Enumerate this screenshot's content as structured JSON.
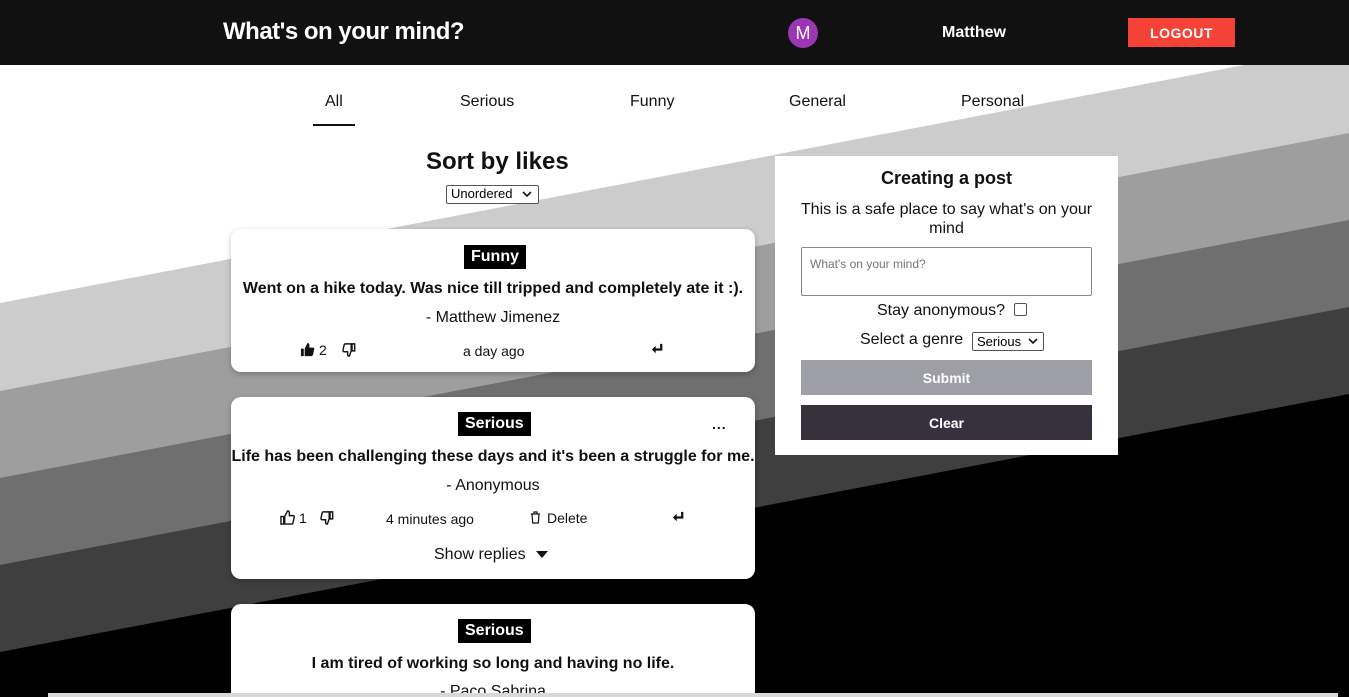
{
  "header": {
    "app_title": "What's on your mind?",
    "avatar_letter": "M",
    "username": "Matthew",
    "logout_label": "LOGOUT"
  },
  "tabs": [
    {
      "label": "All",
      "active": true
    },
    {
      "label": "Serious",
      "active": false
    },
    {
      "label": "Funny",
      "active": false
    },
    {
      "label": "General",
      "active": false
    },
    {
      "label": "Personal",
      "active": false
    }
  ],
  "sort": {
    "title": "Sort by likes",
    "selected": "Unordered"
  },
  "posts": [
    {
      "genre": "Funny",
      "text": "Went on a hike today. Was nice till tripped and completely ate it :).",
      "author": "- Matthew Jimenez",
      "likes": "2",
      "liked": true,
      "time": "a day ago"
    },
    {
      "genre": "Serious",
      "text": "Life has been challenging these days and it's been a struggle for me.",
      "author": "- Anonymous",
      "likes": "1",
      "liked": false,
      "time": "4 minutes ago",
      "delete_label": "Delete",
      "more_label": "...",
      "show_replies_label": "Show replies"
    },
    {
      "genre": "Serious",
      "text": "I am tired of working so long and having no life.",
      "author": "- Paco Sabrina"
    }
  ],
  "create_post": {
    "title": "Creating a post",
    "subtitle": "This is a safe place to say what's on your mind",
    "input_placeholder": "What's on your mind?",
    "anonymous_label": "Stay anonymous?",
    "genre_label": "Select a genre",
    "genre_selected": "Serious",
    "submit_label": "Submit",
    "clear_label": "Clear"
  },
  "colors": {
    "header_bg": "#111111",
    "avatar_bg": "#9c36b5",
    "logout_bg": "#f44336",
    "submit_bg": "#9e9ea6",
    "clear_bg": "#36313d"
  }
}
